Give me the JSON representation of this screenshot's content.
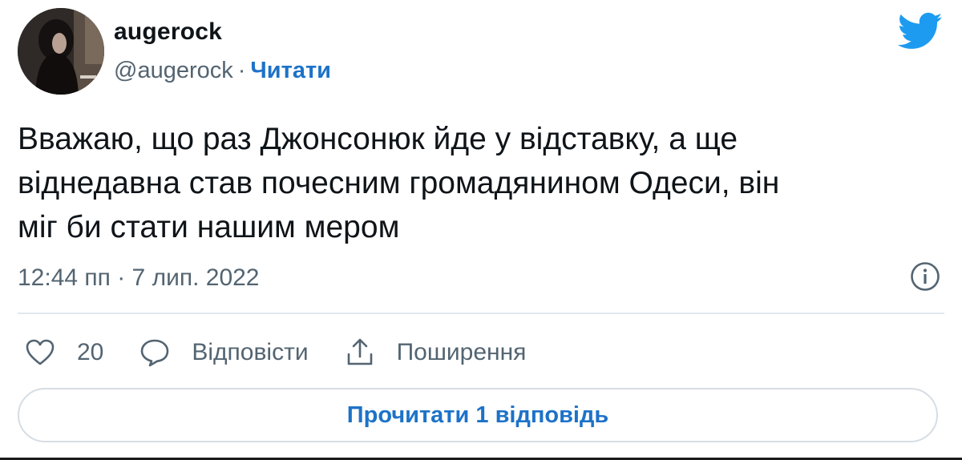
{
  "author": {
    "display_name": "augerock",
    "handle": "@augerock",
    "separator": "·",
    "follow_label": "Читати"
  },
  "brand": {
    "icon": "twitter-bird-icon",
    "color": "#1d9bf0"
  },
  "tweet": {
    "lines": [
      "Вважаю, що раз Джонсонюк йде у відставку, а ще",
      "віднедавна став почесним громадянином Одеси, він",
      "міг би стати нашим мером"
    ],
    "timestamp": "12:44 пп · 7 лип. 2022"
  },
  "actions": {
    "like_count": "20",
    "reply_label": "Відповісти",
    "share_label": "Поширення"
  },
  "footer": {
    "read_replies_label": "Прочитати 1 відповідь"
  },
  "colors": {
    "text": "#0f1419",
    "secondary": "#536471",
    "link": "#1d72c8",
    "divider": "#e1e8ed"
  }
}
